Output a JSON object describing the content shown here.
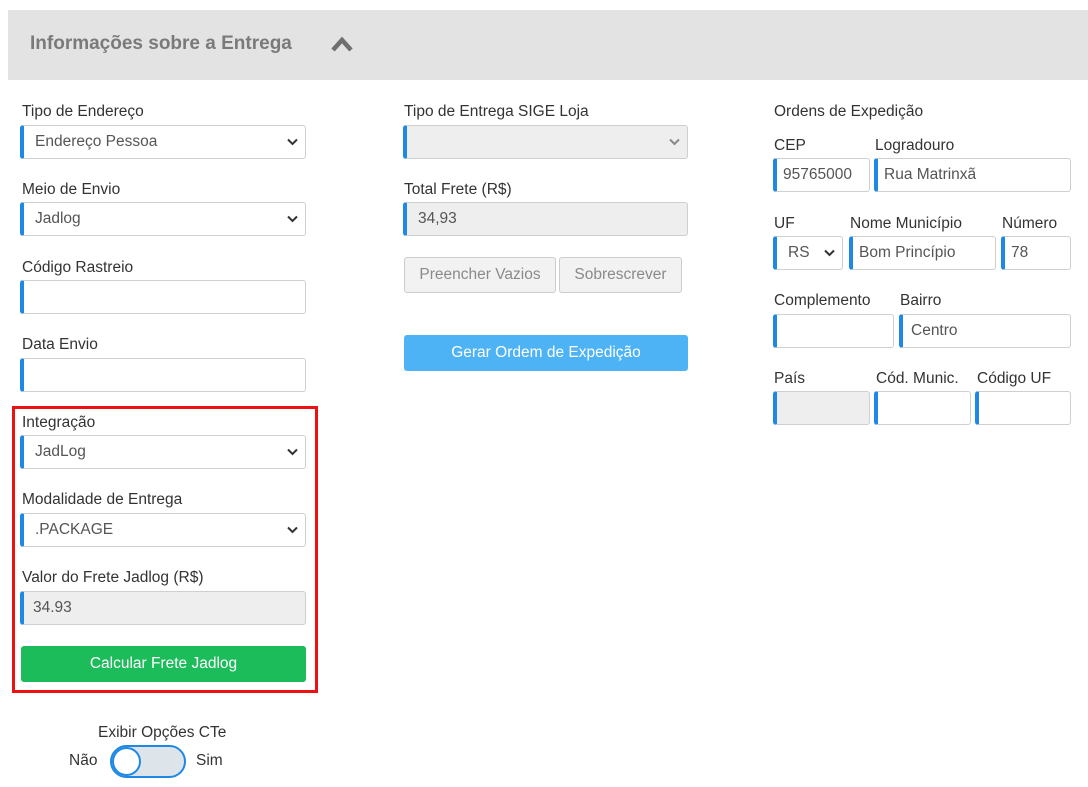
{
  "header": {
    "title": "Informações sobre a Entrega",
    "toggle_icon": "chevron-up-icon"
  },
  "left": {
    "tipo_endereco": {
      "label": "Tipo de Endereço",
      "value": "Endereço Pessoa"
    },
    "meio_envio": {
      "label": "Meio de Envio",
      "value": "Jadlog"
    },
    "codigo_rastreio": {
      "label": "Código Rastreio",
      "value": ""
    },
    "data_envio": {
      "label": "Data Envio",
      "value": ""
    },
    "integracao": {
      "label": "Integração",
      "value": "JadLog"
    },
    "modalidade": {
      "label": "Modalidade de Entrega",
      "value": ".PACKAGE"
    },
    "valor_frete": {
      "label": "Valor do Frete Jadlog (R$)",
      "value": "34.93"
    },
    "calcular_button": "Calcular Frete Jadlog",
    "highlight_color": "#ee1111"
  },
  "middle": {
    "tipo_entrega": {
      "label": "Tipo de Entrega SIGE Loja",
      "value": ""
    },
    "total_frete": {
      "label": "Total Frete (R$)",
      "value": "34,93"
    },
    "preencher_button": "Preencher Vazios",
    "sobrescrever_button": "Sobrescrever",
    "gerar_button": "Gerar Ordem de Expedição"
  },
  "right": {
    "section_title": "Ordens de Expedição",
    "cep": {
      "label": "CEP",
      "value": "95765000"
    },
    "logradouro": {
      "label": "Logradouro",
      "value": "Rua Matrinxã"
    },
    "uf": {
      "label": "UF",
      "value": "RS"
    },
    "municipio": {
      "label": "Nome Município",
      "value": "Bom Princípio"
    },
    "numero": {
      "label": "Número",
      "value": "78"
    },
    "complemento": {
      "label": "Complemento",
      "value": ""
    },
    "bairro": {
      "label": "Bairro",
      "value": "Centro"
    },
    "pais": {
      "label": "País",
      "value": ""
    },
    "cod_munic": {
      "label": "Cód. Munic.",
      "value": ""
    },
    "codigo_uf": {
      "label": "Código UF",
      "value": ""
    }
  },
  "cte": {
    "label": "Exibir Opções CTe",
    "off_label": "Não",
    "on_label": "Sim",
    "checked": false
  },
  "colors": {
    "accent": "#1e88e5",
    "primary_button": "#4db3f5",
    "success_button": "#1cbc5a"
  }
}
